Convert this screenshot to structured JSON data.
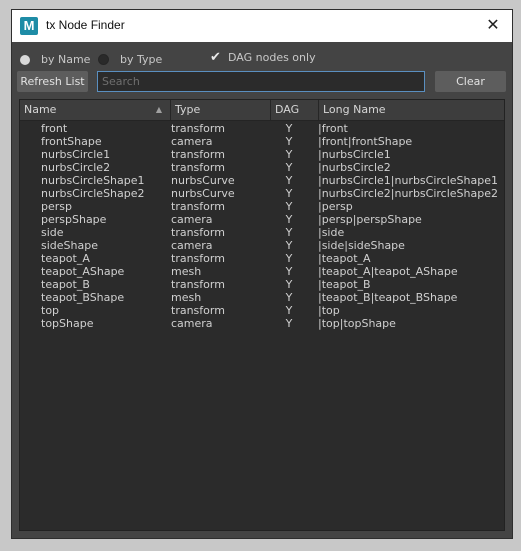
{
  "window": {
    "title": "tx Node Finder",
    "app_icon_letter": "M",
    "close_glyph": "✕"
  },
  "options": {
    "by_name": {
      "label": "by Name",
      "selected": true
    },
    "by_type": {
      "label": "by Type",
      "selected": false
    },
    "dag_only": {
      "label": "DAG nodes only",
      "checked": true,
      "check_glyph": "✔"
    }
  },
  "toolbar": {
    "refresh_label": "Refresh List",
    "search_placeholder": "Search",
    "search_value": "",
    "clear_label": "Clear"
  },
  "table": {
    "columns": [
      "Name",
      "Type",
      "DAG",
      "Long Name"
    ],
    "sort_indicator": "▲",
    "rows": [
      {
        "name": "front",
        "type": "transform",
        "dag": "Y",
        "long": "|front"
      },
      {
        "name": "frontShape",
        "type": "camera",
        "dag": "Y",
        "long": "|front|frontShape"
      },
      {
        "name": "nurbsCircle1",
        "type": "transform",
        "dag": "Y",
        "long": "|nurbsCircle1"
      },
      {
        "name": "nurbsCircle2",
        "type": "transform",
        "dag": "Y",
        "long": "|nurbsCircle2"
      },
      {
        "name": "nurbsCircleShape1",
        "type": "nurbsCurve",
        "dag": "Y",
        "long": "|nurbsCircle1|nurbsCircleShape1"
      },
      {
        "name": "nurbsCircleShape2",
        "type": "nurbsCurve",
        "dag": "Y",
        "long": "|nurbsCircle2|nurbsCircleShape2"
      },
      {
        "name": "persp",
        "type": "transform",
        "dag": "Y",
        "long": "|persp"
      },
      {
        "name": "perspShape",
        "type": "camera",
        "dag": "Y",
        "long": "|persp|perspShape"
      },
      {
        "name": "side",
        "type": "transform",
        "dag": "Y",
        "long": "|side"
      },
      {
        "name": "sideShape",
        "type": "camera",
        "dag": "Y",
        "long": "|side|sideShape"
      },
      {
        "name": "teapot_A",
        "type": "transform",
        "dag": "Y",
        "long": "|teapot_A"
      },
      {
        "name": "teapot_AShape",
        "type": "mesh",
        "dag": "Y",
        "long": "|teapot_A|teapot_AShape"
      },
      {
        "name": "teapot_B",
        "type": "transform",
        "dag": "Y",
        "long": "|teapot_B"
      },
      {
        "name": "teapot_BShape",
        "type": "mesh",
        "dag": "Y",
        "long": "|teapot_B|teapot_BShape"
      },
      {
        "name": "top",
        "type": "transform",
        "dag": "Y",
        "long": "|top"
      },
      {
        "name": "topShape",
        "type": "camera",
        "dag": "Y",
        "long": "|top|topShape"
      }
    ]
  }
}
